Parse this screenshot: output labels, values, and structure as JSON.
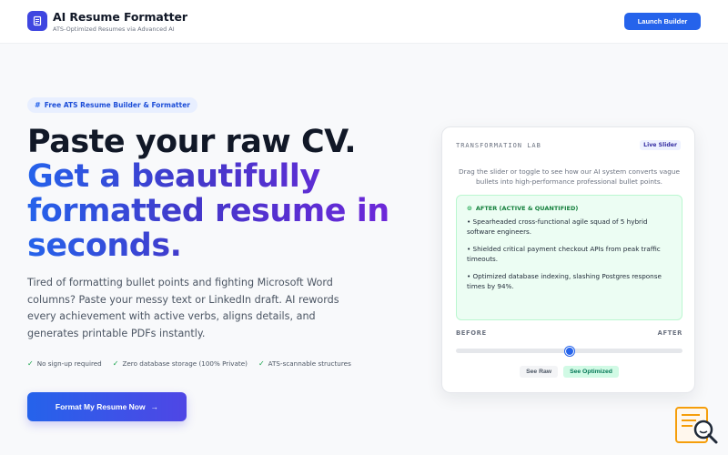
{
  "header": {
    "app_title": "AI Resume Formatter",
    "app_subtitle": "ATS-Optimized Resumes via Advanced AI",
    "launch_label": "Launch Builder"
  },
  "hero": {
    "badge": "Free ATS Resume Builder & Formatter",
    "headline_line1": "Paste your raw CV.",
    "headline_line2": "Get a beautifully",
    "headline_line3": "formatted resume in",
    "headline_line4": "seconds.",
    "description": "Tired of formatting bullet points and fighting Microsoft Word columns? Paste your messy text or LinkedIn draft. AI rewords every achievement with active verbs, aligns details, and generates printable PDFs instantly.",
    "checks": [
      "No sign-up required",
      "Zero database storage (100% Private)",
      "ATS-scannable structures"
    ],
    "cta_label": "Format My Resume Now",
    "cta_arrow": "→"
  },
  "lab": {
    "title": "TRANSFORMATION LAB",
    "pill": "Live Slider",
    "instructions": "Drag the slider or toggle to see how our AI system converts vague bullets into high-performance professional bullet points.",
    "after_heading": "AFTER (ACTIVE & QUANTIFIED)",
    "bullets": [
      "• Spearheaded cross-functional agile squad of 5 hybrid software engineers.",
      "• Shielded critical payment checkout APIs from peak traffic timeouts.",
      "• Optimized database indexing, slashing Postgres response times by 94%."
    ],
    "before_label": "BEFORE",
    "after_label": "AFTER",
    "slider_value": 0.5,
    "toggle_raw": "See Raw",
    "toggle_optimized": "See Optimized"
  },
  "colors": {
    "primary": "#2563eb",
    "success": "#16a34a",
    "widget": "#f59e0b"
  },
  "icons": {
    "logo": "document-icon",
    "badge": "hash-icon",
    "check": "check-icon",
    "after": "check-circle-icon",
    "widget": "search-document-icon"
  }
}
